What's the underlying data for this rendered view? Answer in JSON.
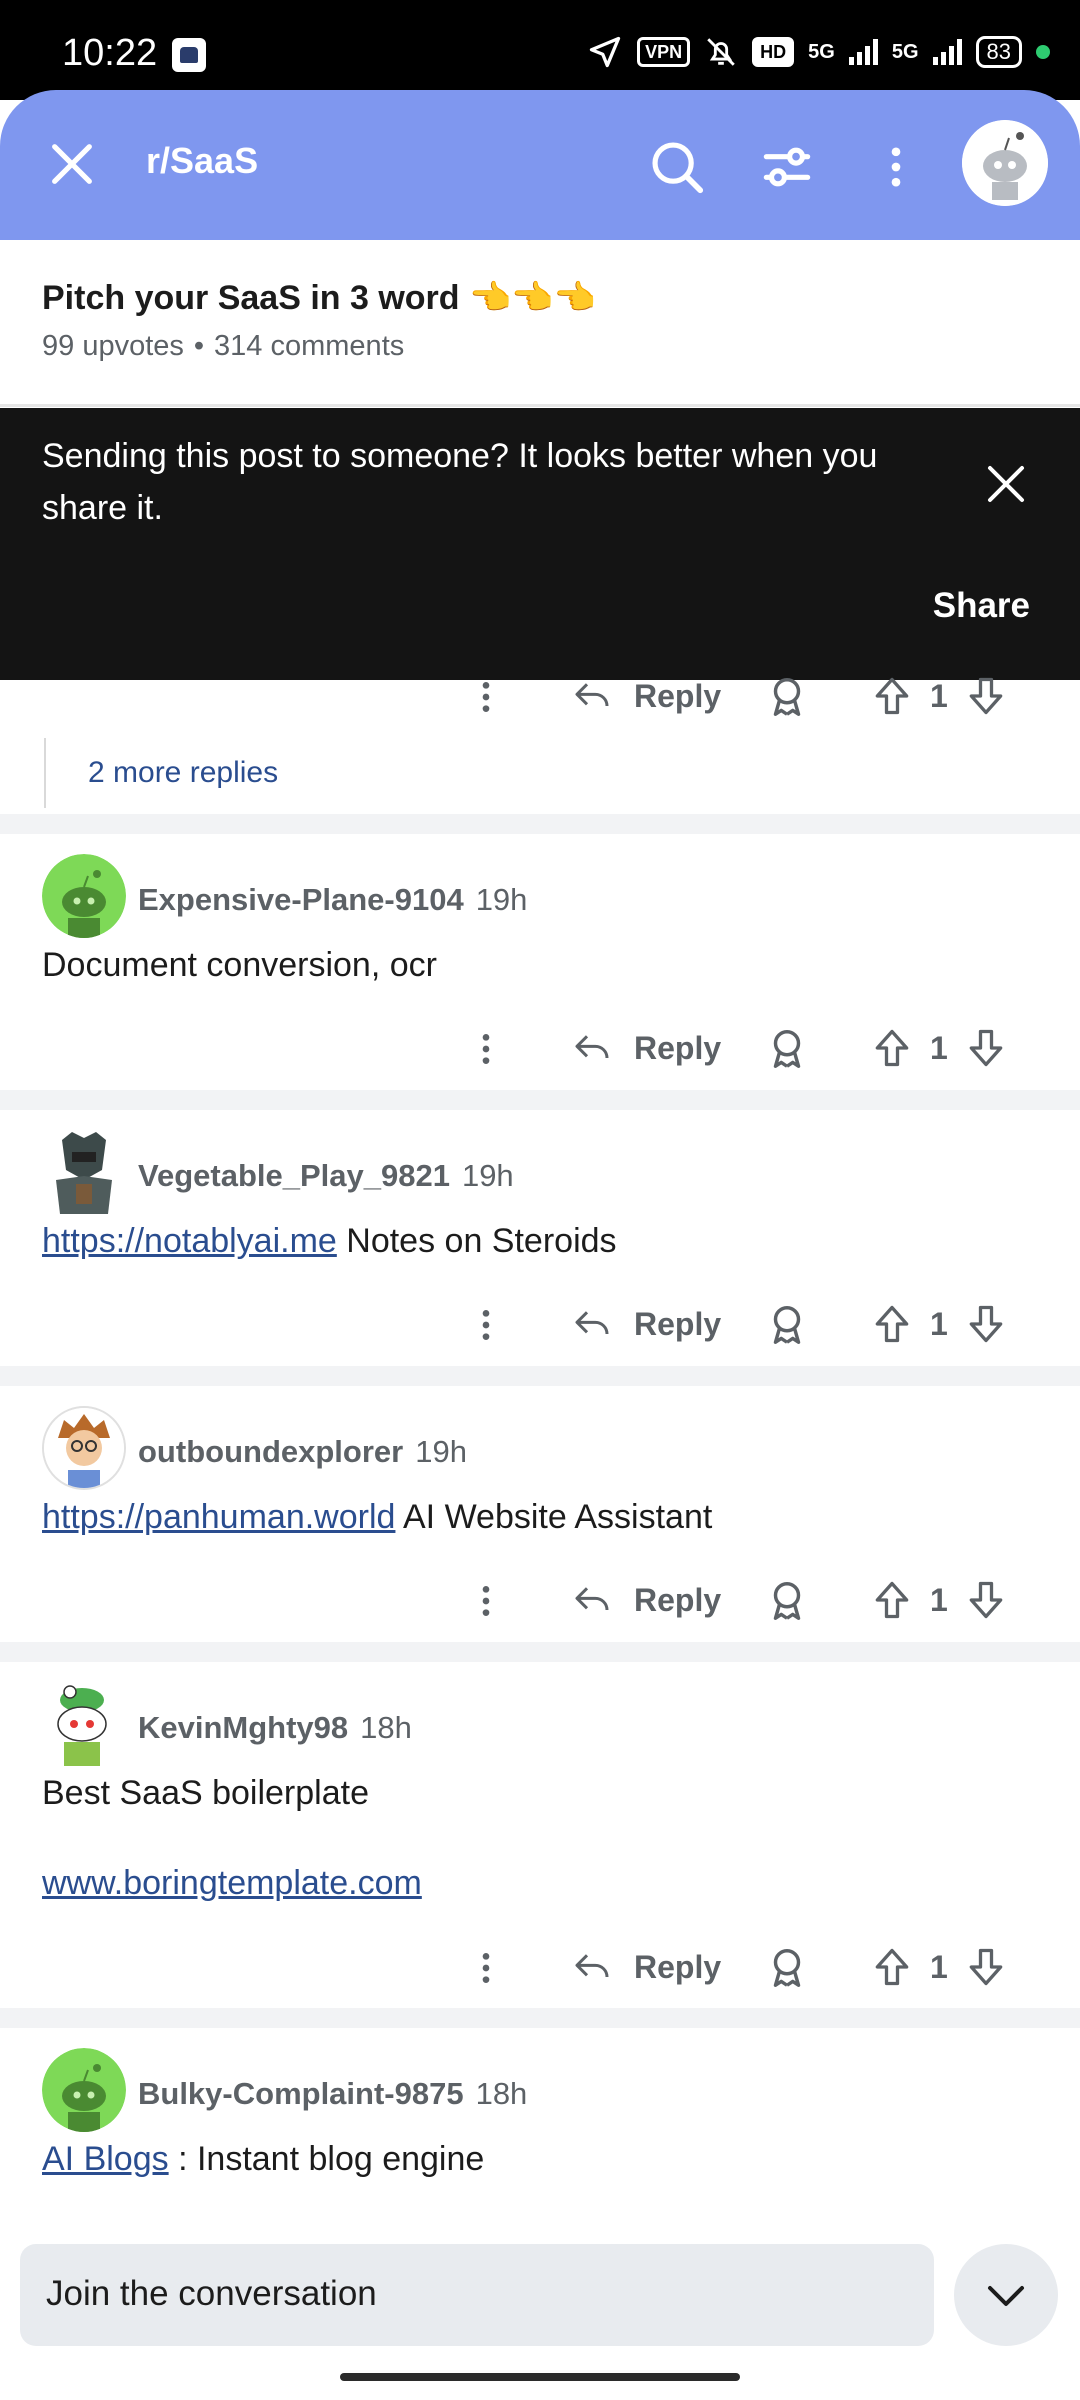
{
  "status_bar": {
    "time": "10:22",
    "vpn": "VPN",
    "hd": "HD",
    "network1": "5G",
    "network2": "5G",
    "battery": "83"
  },
  "header": {
    "title": "r/SaaS"
  },
  "post": {
    "title": "Pitch your SaaS in 3 word 👈👈👈",
    "upvotes": "99 upvotes",
    "dot": "•",
    "comments": "314 comments"
  },
  "share_banner": {
    "text": "Sending this post to someone? It looks better when you share it.",
    "button": "Share"
  },
  "thread": {
    "more_replies": "2 more replies"
  },
  "actions": {
    "reply_label": "Reply"
  },
  "comments": [
    {
      "user": "Expensive-Plane-9104",
      "time": "19h",
      "text": "Document conversion, ocr",
      "votes": "1"
    },
    {
      "user": "Vegetable_Play_9821",
      "time": "19h",
      "link": "https://notablyai.me",
      "text": " Notes on Steroids",
      "votes": "1"
    },
    {
      "user": "outboundexplorer",
      "time": "19h",
      "link": "https://panhuman.world",
      "text": " AI Website Assistant",
      "votes": "1"
    },
    {
      "user": "KevinMghty98",
      "time": "18h",
      "text": "Best SaaS boilerplate",
      "link": "www.boringtemplate.com",
      "votes": "1"
    },
    {
      "user": "Bulky-Complaint-9875",
      "time": "18h",
      "link": "AI Blogs",
      "text": " : Instant blog engine"
    }
  ],
  "top_reply_votes": "1",
  "bottom": {
    "placeholder": "Join the conversation"
  },
  "colors": {
    "header_bg": "#7f97ef",
    "banner_bg": "#141414",
    "link": "#2a4d8f",
    "avatar_green": "#7ed957"
  }
}
